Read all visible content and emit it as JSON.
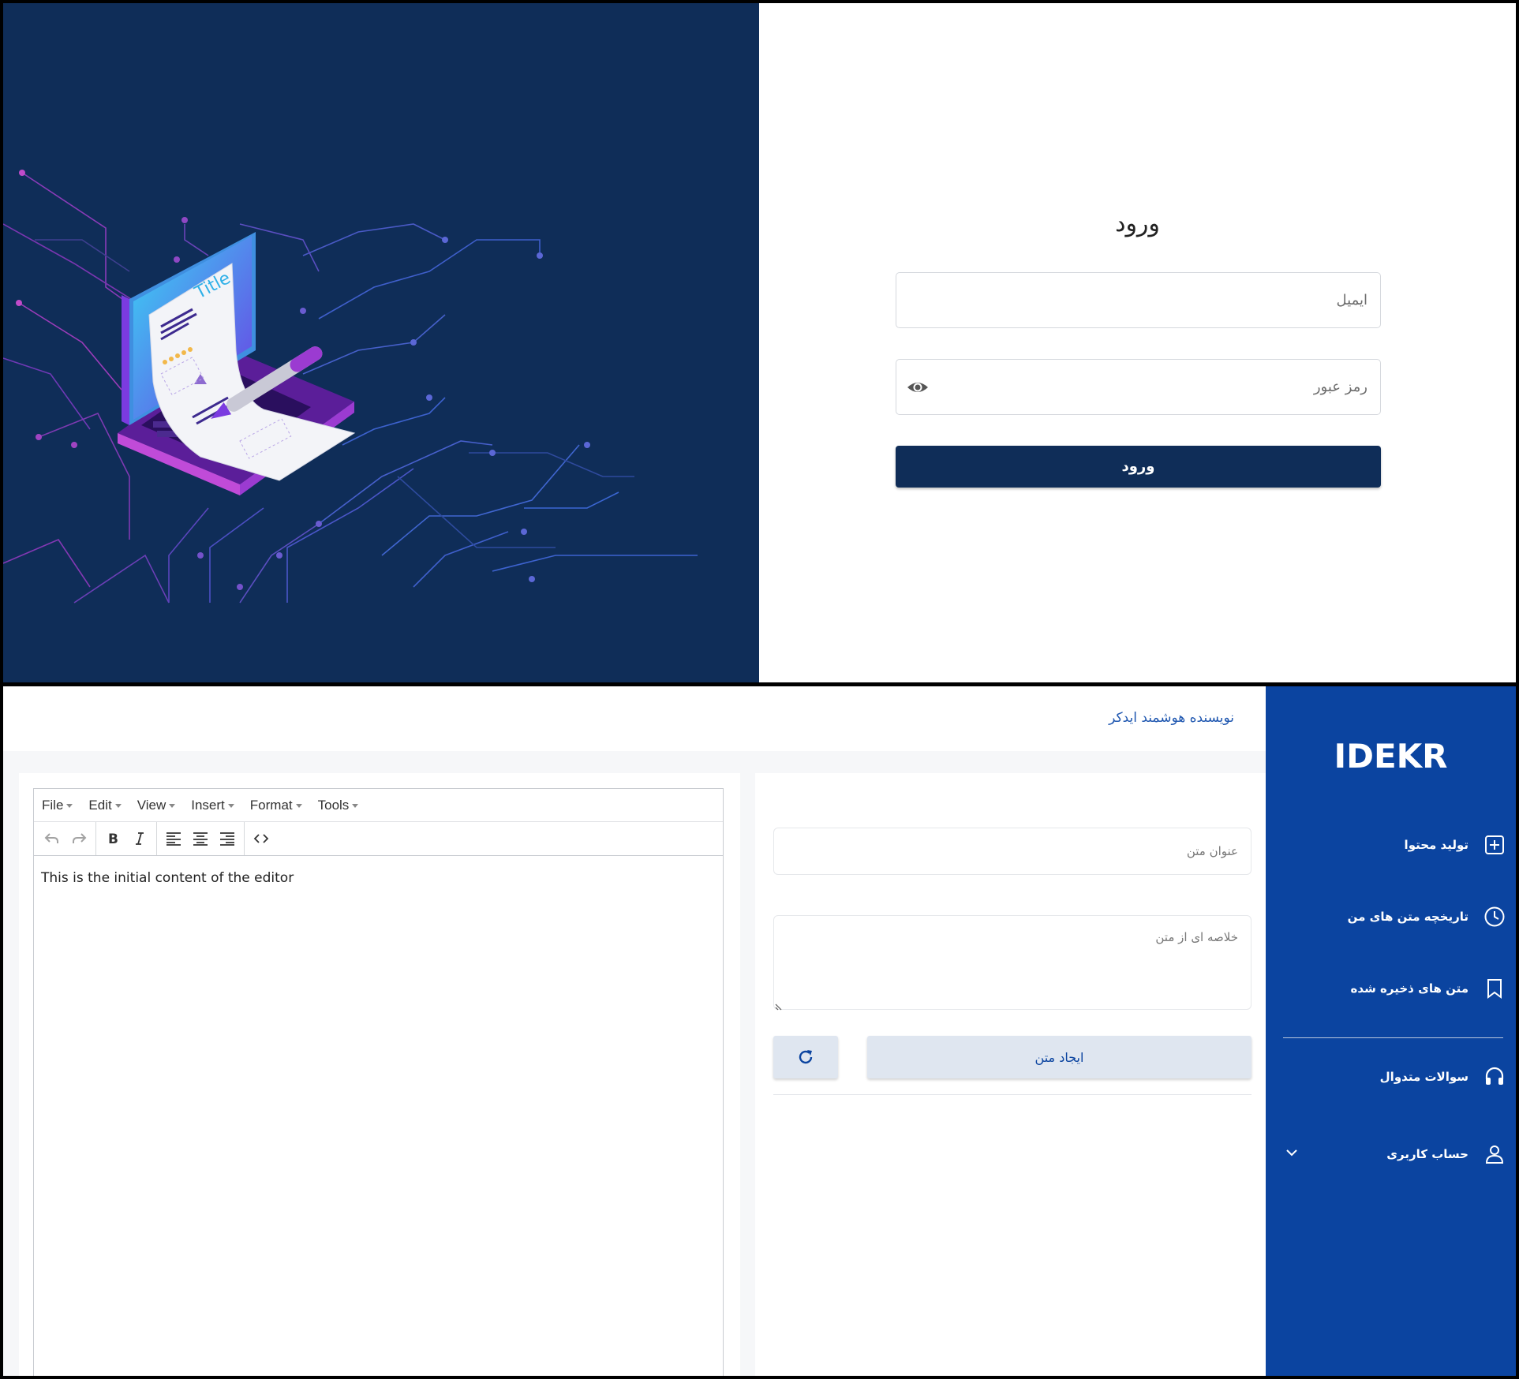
{
  "login": {
    "title": "ورود",
    "email_placeholder": "ایمیل",
    "password_placeholder": "رمز عبور",
    "submit_label": "ورود",
    "illustration_label": "Title",
    "colors": {
      "panel_bg": "#0f2d58",
      "button_bg": "#0f2d58"
    }
  },
  "app": {
    "header_title": "نویسنده هوشمند ایدکر",
    "logo_text": "IDEKR",
    "sidebar": {
      "items": [
        {
          "label": "تولید محتوا",
          "icon": "plus-square-icon"
        },
        {
          "label": "تاریخچه متن های من",
          "icon": "clock-icon"
        },
        {
          "label": "متن های ذخیره شده",
          "icon": "bookmark-icon"
        },
        {
          "label": "سوالات متدوال",
          "icon": "headset-icon"
        },
        {
          "label": "حساب کاربری",
          "icon": "user-icon"
        }
      ],
      "colors": {
        "bg": "#0b44a0"
      }
    },
    "editor": {
      "menu": [
        "File",
        "Edit",
        "View",
        "Insert",
        "Format",
        "Tools"
      ],
      "content": "This is the initial content of the editor"
    },
    "form": {
      "title_placeholder": "عنوان متن",
      "summary_placeholder": "خلاصه ای از متن",
      "create_label": "ایجاد متن"
    }
  }
}
